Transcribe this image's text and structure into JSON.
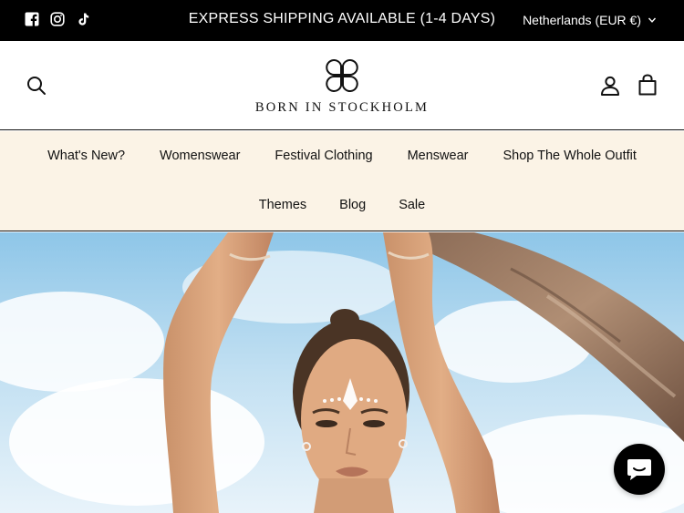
{
  "announcement": {
    "text": "EXPRESS SHIPPING AVAILABLE (1-4 DAYS)",
    "social_icons": [
      "facebook-icon",
      "instagram-icon",
      "tiktok-icon"
    ],
    "currency_label": "Netherlands (EUR €)"
  },
  "header": {
    "brand": "BORN IN STOCKHOLM",
    "icons": [
      "search-icon",
      "clover-logo",
      "account-icon",
      "bag-icon"
    ]
  },
  "nav": {
    "row1": [
      "What's New?",
      "Womenswear",
      "Festival Clothing",
      "Menswear",
      "Shop The Whole Outfit"
    ],
    "row2": [
      "Themes",
      "Blog",
      "Sale"
    ]
  },
  "colors": {
    "topbar": "#000000",
    "nav_bg": "#fbf3e6",
    "chat": "#000000"
  },
  "chat": {
    "icon": "chat-bubble-icon"
  }
}
